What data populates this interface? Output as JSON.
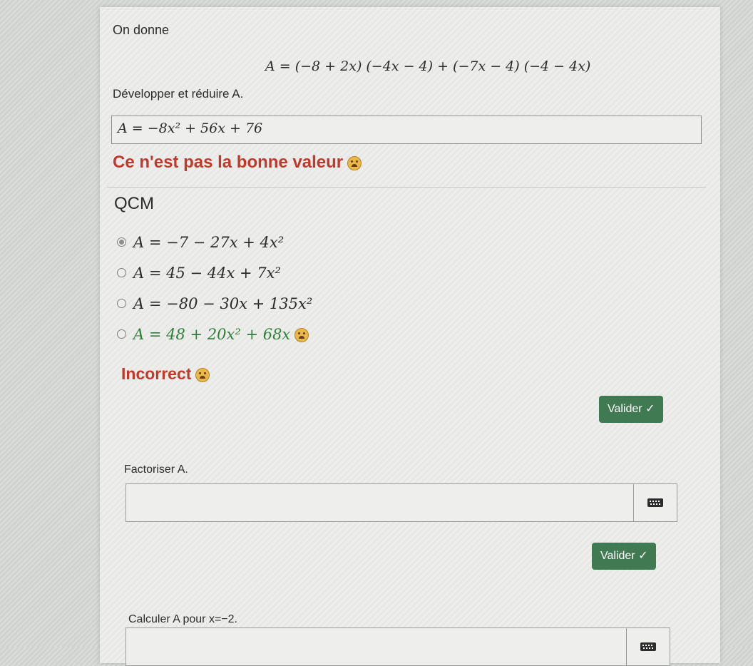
{
  "exercise": {
    "intro": "On donne",
    "expression": "A = (−8 + 2x) (−4x − 4) + (−7x − 4) (−4 − 4x)",
    "task": "Développer et réduire A.",
    "answer_value": "A = −8x² + 56x + 76",
    "answer_feedback": "Ce n'est pas la bonne valeur",
    "feedback_icon": "sad-emoji-icon"
  },
  "qcm": {
    "title": "QCM",
    "options": [
      {
        "text": "A = −7 − 27x + 4x²",
        "selected": true,
        "correct": false
      },
      {
        "text": "A = 45 − 44x + 7x²",
        "selected": false,
        "correct": false
      },
      {
        "text": "A = −80 − 30x + 135x²",
        "selected": false,
        "correct": false
      },
      {
        "text": "A = 48 + 20x² + 68x",
        "selected": false,
        "correct": true
      }
    ],
    "result": "Incorrect",
    "submit_label": "Valider ✓"
  },
  "factor": {
    "task": "Factoriser A.",
    "input_value": "",
    "keyboard_icon": "keyboard-icon",
    "submit_label": "Valider ✓"
  },
  "evaluate": {
    "task": "Calculer A pour x=−2.",
    "input_value": ""
  },
  "colors": {
    "error": "#c0392b",
    "correct": "#2f7f3a",
    "button": "#3f7a52"
  }
}
